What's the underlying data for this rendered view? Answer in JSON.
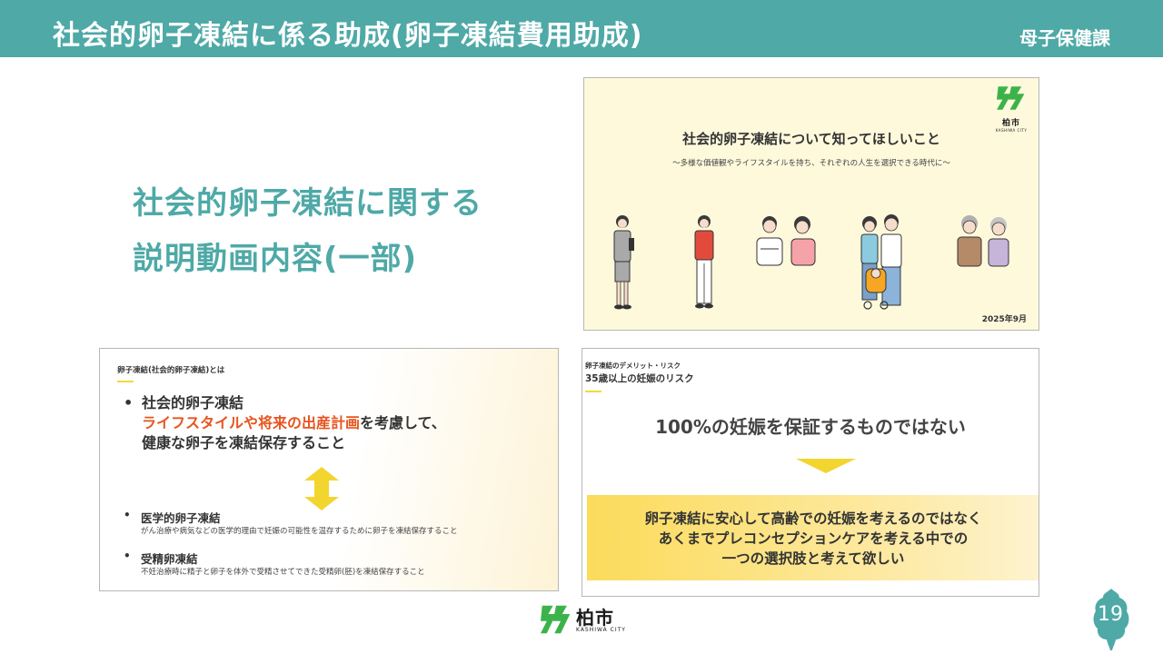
{
  "header": {
    "title": "社会的卵子凍結に係る助成(卵子凍結費用助成)",
    "department": "母子保健課"
  },
  "heading": {
    "line1": "社会的卵子凍結に関する",
    "line2": "説明動画内容(一部)"
  },
  "cover_slide": {
    "logo_text": "柏市",
    "logo_sub": "KASHIWA CITY",
    "title": "社会的卵子凍結について知ってほしいこと",
    "subtitle": "〜多様な価値観やライフスタイルを持ち、それぞれの人生を選択できる時代に〜",
    "date": "2025年9月"
  },
  "definition_slide": {
    "kicker": "卵子凍結(社会的卵子凍結)とは",
    "bullet_heading": "社会的卵子凍結",
    "bullet_highlight": "ライフスタイルや将来の出産計画",
    "bullet_rest": "を考慮して、",
    "bullet_line3": "健康な卵子を凍結保存すること",
    "item1_heading": "医学的卵子凍結",
    "item1_desc": "がん治療や病気などの医学的理由で妊娠の可能性を温存するために卵子を凍結保存すること",
    "item2_heading": "受精卵凍結",
    "item2_desc": "不妊治療時に精子と卵子を体外で受精させてできた受精卵(胚)を凍結保存すること",
    "highlight_color": "#e8541e"
  },
  "risk_slide": {
    "kicker": "卵子凍結のデメリット・リスク",
    "kicker2": "35歳以上の妊娠のリスク",
    "main": "100%の妊娠を保証するものではない",
    "box_line1": "卵子凍結に安心して高齢での妊娠を考えるのではなく",
    "box_line2": "あくまでプレコンセプションケアを考える中での",
    "box_line3": "一つの選択肢と考えて欲しい"
  },
  "footer": {
    "logo_text": "柏市",
    "logo_sub": "KASHIWA CITY",
    "page_number": "19"
  },
  "colors": {
    "teal": "#4ea9a7",
    "accent_yellow": "#f5d83b",
    "logo_green": "#3bb34a"
  }
}
